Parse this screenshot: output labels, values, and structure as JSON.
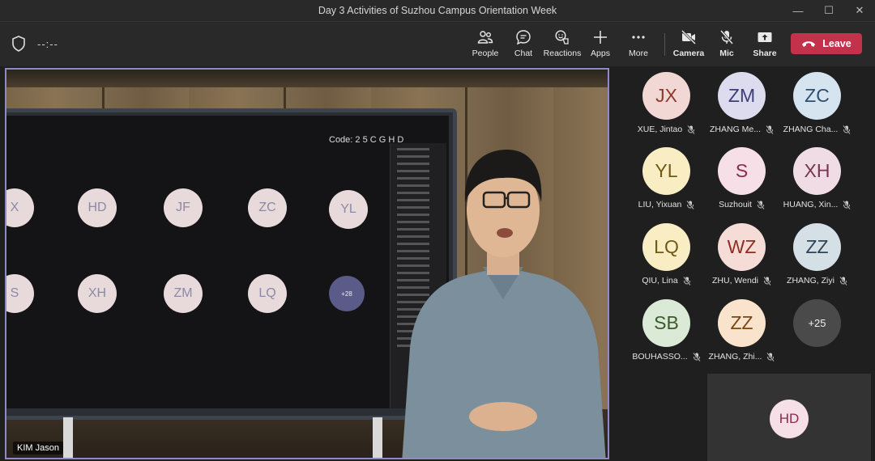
{
  "window": {
    "title": "Day 3 Activities of Suzhou Campus Orientation Week"
  },
  "toolbar": {
    "timer": "--:--",
    "people": "People",
    "chat": "Chat",
    "reactions": "Reactions",
    "apps": "Apps",
    "more": "More",
    "camera": "Camera",
    "mic": "Mic",
    "share": "Share",
    "leave": "Leave",
    "leave_color": "#c4314b"
  },
  "stage": {
    "speaker_name": "KIM Jason",
    "screen": {
      "code_label": "Code: 2 5 C G H D",
      "avatars": [
        "X",
        "HD",
        "JF",
        "ZC",
        "YL",
        "S",
        "XH",
        "ZM",
        "LQ"
      ],
      "more": "+28"
    }
  },
  "participants": [
    {
      "initials": "JX",
      "name": "XUE, Jintao",
      "bg": "#f1d8d4",
      "fg": "#8e3a2a"
    },
    {
      "initials": "ZM",
      "name": "ZHANG Me...",
      "bg": "#dcdcee",
      "fg": "#3e3e78"
    },
    {
      "initials": "ZC",
      "name": "ZHANG Cha...",
      "bg": "#d6e4f0",
      "fg": "#2d4f70"
    },
    {
      "initials": "YL",
      "name": "LIU, Yixuan",
      "bg": "#f9edc4",
      "fg": "#6e5a12"
    },
    {
      "initials": "S",
      "name": "Suzhouit",
      "bg": "#f6dfe6",
      "fg": "#8b2a4b"
    },
    {
      "initials": "XH",
      "name": "HUANG, Xin...",
      "bg": "#f0dce4",
      "fg": "#7a3552"
    },
    {
      "initials": "LQ",
      "name": "QIU, Lina",
      "bg": "#f9edc4",
      "fg": "#6e5a12"
    },
    {
      "initials": "WZ",
      "name": "ZHU, Wendi",
      "bg": "#f6dcd6",
      "fg": "#8e2e22"
    },
    {
      "initials": "ZZ",
      "name": "ZHANG, Ziyi",
      "bg": "#d5dfe6",
      "fg": "#2f4556"
    },
    {
      "initials": "SB",
      "name": "BOUHASSO...",
      "bg": "#dbead6",
      "fg": "#3a5a2e"
    },
    {
      "initials": "ZZ",
      "name": "ZHANG, Zhi...",
      "bg": "#fae3cc",
      "fg": "#7a4614"
    },
    {
      "initials": "+25",
      "name": "",
      "bg": "#4a4a4a",
      "fg": "#f0f0f0"
    }
  ],
  "self_view": {
    "initials": "HD"
  }
}
